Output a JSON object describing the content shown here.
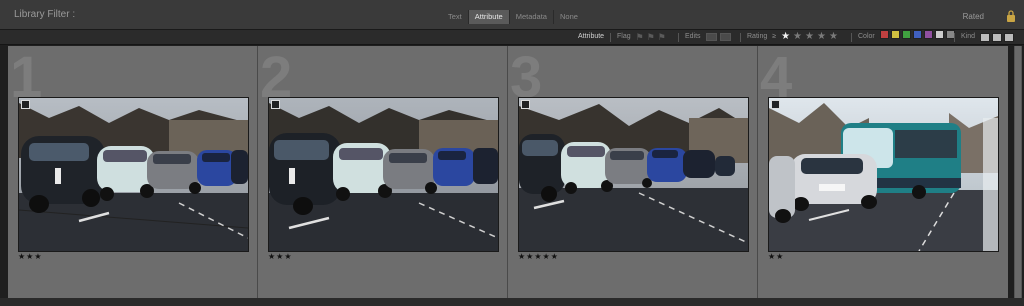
{
  "filter_bar": {
    "title": "Library Filter :",
    "modes": [
      "Text",
      "Attribute",
      "Metadata",
      "None"
    ],
    "active_mode": "Attribute",
    "rated_label": "Rated"
  },
  "attribute_bar": {
    "attribute_label": "Attribute",
    "flag_label": "Flag",
    "edits_label": "Edits",
    "rating_label": "Rating",
    "rating_operator": "≥",
    "rating_value": 1,
    "color_label": "Color",
    "color_swatches": [
      "#c04040",
      "#d0c040",
      "#40a040",
      "#4060c0",
      "#9050a0",
      "#cccccc",
      "#888888"
    ],
    "kind_label": "Kind"
  },
  "photos": [
    {
      "number": "1",
      "stars": "★★★",
      "rating": 3
    },
    {
      "number": "2",
      "stars": "★★★",
      "rating": 3
    },
    {
      "number": "3",
      "stars": "★★★★★",
      "rating": 5
    },
    {
      "number": "4",
      "stars": "★★",
      "rating": 2
    }
  ]
}
